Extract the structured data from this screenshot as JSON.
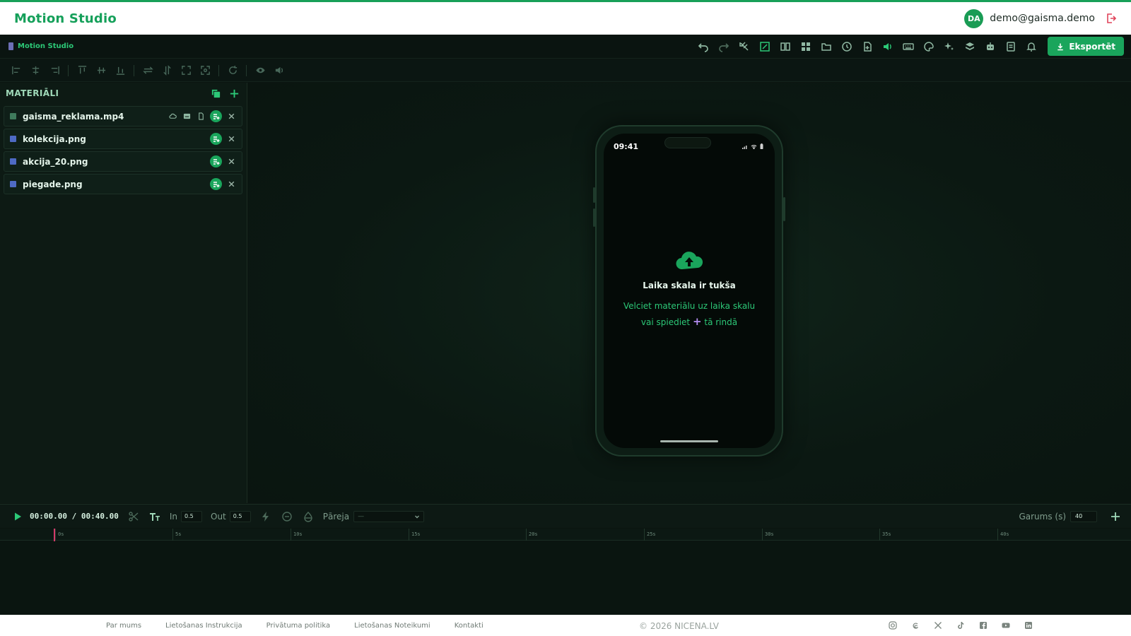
{
  "header": {
    "brand": "Motion Studio",
    "avatar_initials": "DA",
    "user_email": "demo@gaisma.demo"
  },
  "editor": {
    "mini_brand": "Motion Studio",
    "export_label": "Eksportēt",
    "toolbar_icons": [
      "undo-icon",
      "redo-icon",
      "magnet-icon",
      "aspect-ratio-icon",
      "compare-icon",
      "grid-icon",
      "folder-icon",
      "history-icon",
      "file-add-icon",
      "volume-icon",
      "keyboard-icon",
      "palette-icon",
      "sparkles-icon",
      "layers-icon",
      "robot-icon",
      "notes-icon",
      "bell-icon"
    ]
  },
  "materials": {
    "title": "MATERIĀLI",
    "items": [
      {
        "name": "gaisma_reklama.mp4",
        "type": "video"
      },
      {
        "name": "kolekcija.png",
        "type": "image"
      },
      {
        "name": "akcija_20.png",
        "type": "image"
      },
      {
        "name": "piegade.png",
        "type": "image"
      }
    ]
  },
  "preview": {
    "clock": "09:41",
    "empty_title": "Laika skala ir tukša",
    "empty_line1": "Velciet materiālu uz laika skalu",
    "empty_line2_a": "vai spiediet",
    "empty_line2_plus": "+",
    "empty_line2_b": "tā rindā"
  },
  "timeline": {
    "timecode": "00:00.00 / 00:40.00",
    "in_label": "In",
    "in_value": "0.5",
    "out_label": "Out",
    "out_value": "0.5",
    "transition_label": "Pāreja",
    "transition_value": "—",
    "length_label": "Garums (s)",
    "length_value": "40",
    "ruler": [
      "0s",
      "5s",
      "10s",
      "15s",
      "20s",
      "25s",
      "30s",
      "35s",
      "40s"
    ]
  },
  "footer": {
    "links": [
      "Par mums",
      "Lietošanas Instrukcija",
      "Privātuma politika",
      "Lietošanas Noteikumi",
      "Kontakti"
    ],
    "copyright": "© 2026 NICENA.LV",
    "socials": [
      "instagram-icon",
      "threads-icon",
      "x-icon",
      "tiktok-icon",
      "facebook-icon",
      "youtube-icon",
      "linkedin-icon"
    ]
  }
}
